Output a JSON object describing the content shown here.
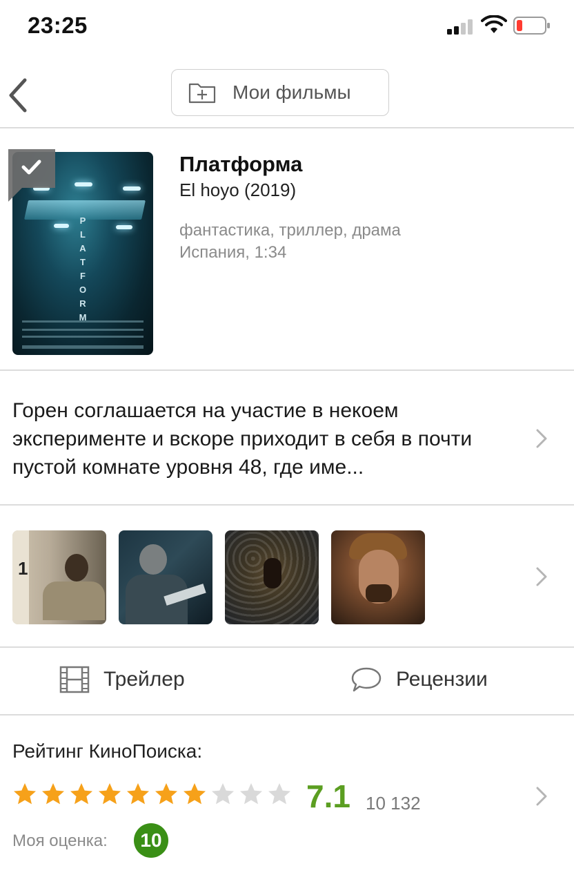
{
  "status_bar": {
    "time": "23:25"
  },
  "nav": {
    "my_films_label": "Мои фильмы"
  },
  "movie": {
    "title": "Платформа",
    "original_title": "El hoyo (2019)",
    "genres": "фантастика, триллер, драма",
    "meta": "Испания, 1:34",
    "poster_title_letters": [
      "P",
      "L",
      "A",
      "T",
      "F",
      "O",
      "R",
      "M"
    ]
  },
  "description": "Горен соглашается на участие в некоем эксперименте и вскоре приходит в себя в почти пустой комнате уровня 48, где име...",
  "actions": {
    "trailer_label": "Трейлер",
    "reviews_label": "Рецензии"
  },
  "rating": {
    "title": "Рейтинг КиноПоиска:",
    "stars_filled": 7,
    "stars_total": 10,
    "value": "7.1",
    "votes": "10 132",
    "my_rating_label": "Моя оценка:",
    "my_rating_value": "10"
  },
  "colors": {
    "rating_green": "#5b9e21",
    "badge_green": "#3a8f16",
    "star_filled": "#f6a11a",
    "star_empty": "#d9d9d9",
    "battery_low": "#ff3b30"
  },
  "icons": [
    "chevron-left-icon",
    "folder-plus-icon",
    "checkmark-icon",
    "chevron-right-icon",
    "film-icon",
    "speech-bubble-icon",
    "star-icon"
  ]
}
